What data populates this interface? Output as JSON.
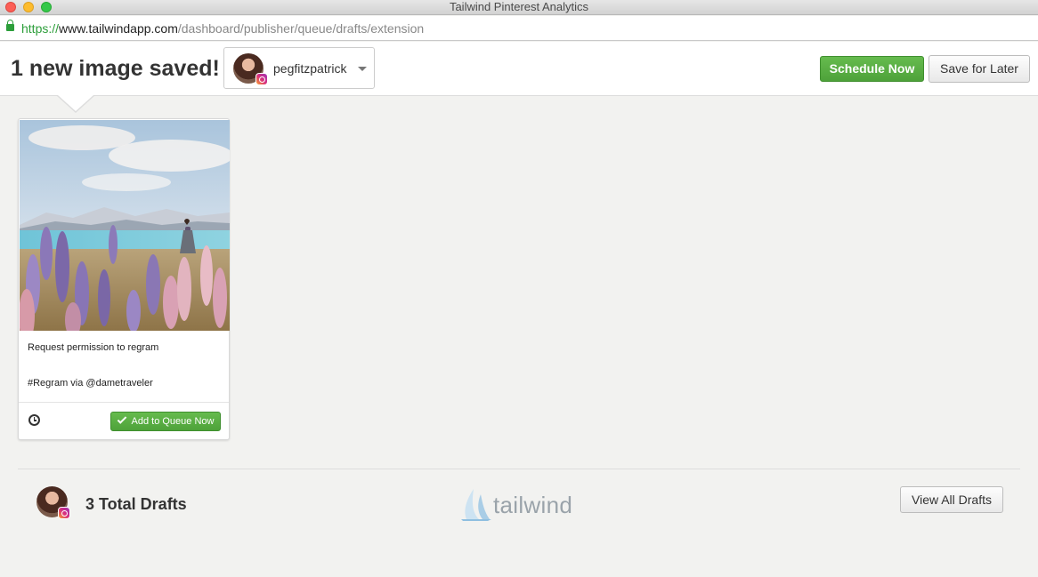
{
  "window": {
    "title": "Tailwind Pinterest Analytics"
  },
  "urlbar": {
    "scheme": "https://",
    "host": "www.tailwindapp.com",
    "path": "/dashboard/publisher/queue/drafts/extension"
  },
  "header": {
    "title": "1 new image saved!",
    "account_name": "pegfitzpatrick",
    "schedule_label": "Schedule Now",
    "later_label": "Save for Later"
  },
  "card": {
    "caption_line1": "Request permission to regram",
    "caption_line2": "#Regram via @dametraveler",
    "queue_label": "Add to Queue Now"
  },
  "footer": {
    "drafts_label": "3 Total Drafts",
    "logo_text": "tailwind",
    "view_drafts_label": "View All Drafts"
  },
  "colors": {
    "accent_green": "#5cb247",
    "instagram_gradient": [
      "#f9a12e",
      "#d92e7f",
      "#9b36b7"
    ]
  },
  "icons": [
    "lock-icon",
    "caret-down-icon",
    "instagram-icon",
    "clock-icon",
    "check-icon",
    "tailwind-logo-icon"
  ]
}
